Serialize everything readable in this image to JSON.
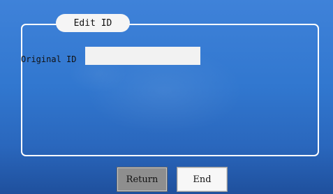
{
  "dialog": {
    "title": "Edit ID",
    "original_id_label": "Original ID",
    "original_id_value": ""
  },
  "buttons": {
    "return_label": "Return",
    "end_label": "End"
  },
  "colors": {
    "background_top": "#3f82d9",
    "background_bottom": "#1f509d",
    "panel_border": "#ffffff",
    "return_button": "#8e8e8e",
    "end_button": "#f7f7f7"
  }
}
